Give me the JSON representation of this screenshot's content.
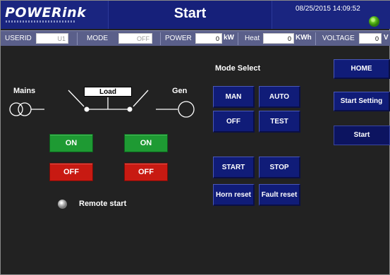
{
  "header": {
    "logo": "POWERink",
    "title": "Start",
    "datetime": "08/25/2015 14:09:52",
    "status_led_color": "#5fbf1d"
  },
  "statusbar": {
    "userid_label": "USERID",
    "userid_value": "U1",
    "mode_label": "MODE",
    "mode_value": "OFF",
    "power_label": "POWER",
    "power_value": "0",
    "power_unit": "kW",
    "heat_label": "Heat",
    "heat_value": "0",
    "heat_unit": "KWh",
    "voltage_label": "VOLTAGE",
    "voltage_value": "0",
    "voltage_unit": "V"
  },
  "diagram": {
    "mains_label": "Mains",
    "load_label": "Load",
    "gen_label": "Gen"
  },
  "controls": {
    "mains_on": "ON",
    "mains_off": "OFF",
    "gen_on": "ON",
    "gen_off": "OFF",
    "remote_start": "Remote start"
  },
  "mode": {
    "title": "Mode Select",
    "man": "MAN",
    "auto": "AUTO",
    "off": "OFF",
    "test": "TEST",
    "start": "START",
    "stop": "STOP",
    "horn_reset": "Horn reset",
    "fault_reset": "Fault reset"
  },
  "nav": {
    "home": "HOME",
    "start_setting": "Start Setting",
    "start": "Start"
  },
  "colors": {
    "header_bg": "#1a2580",
    "panel_bg": "#222222",
    "on_green": "#1e9a33",
    "off_red": "#c81a12",
    "button_blue": "#101c78"
  }
}
